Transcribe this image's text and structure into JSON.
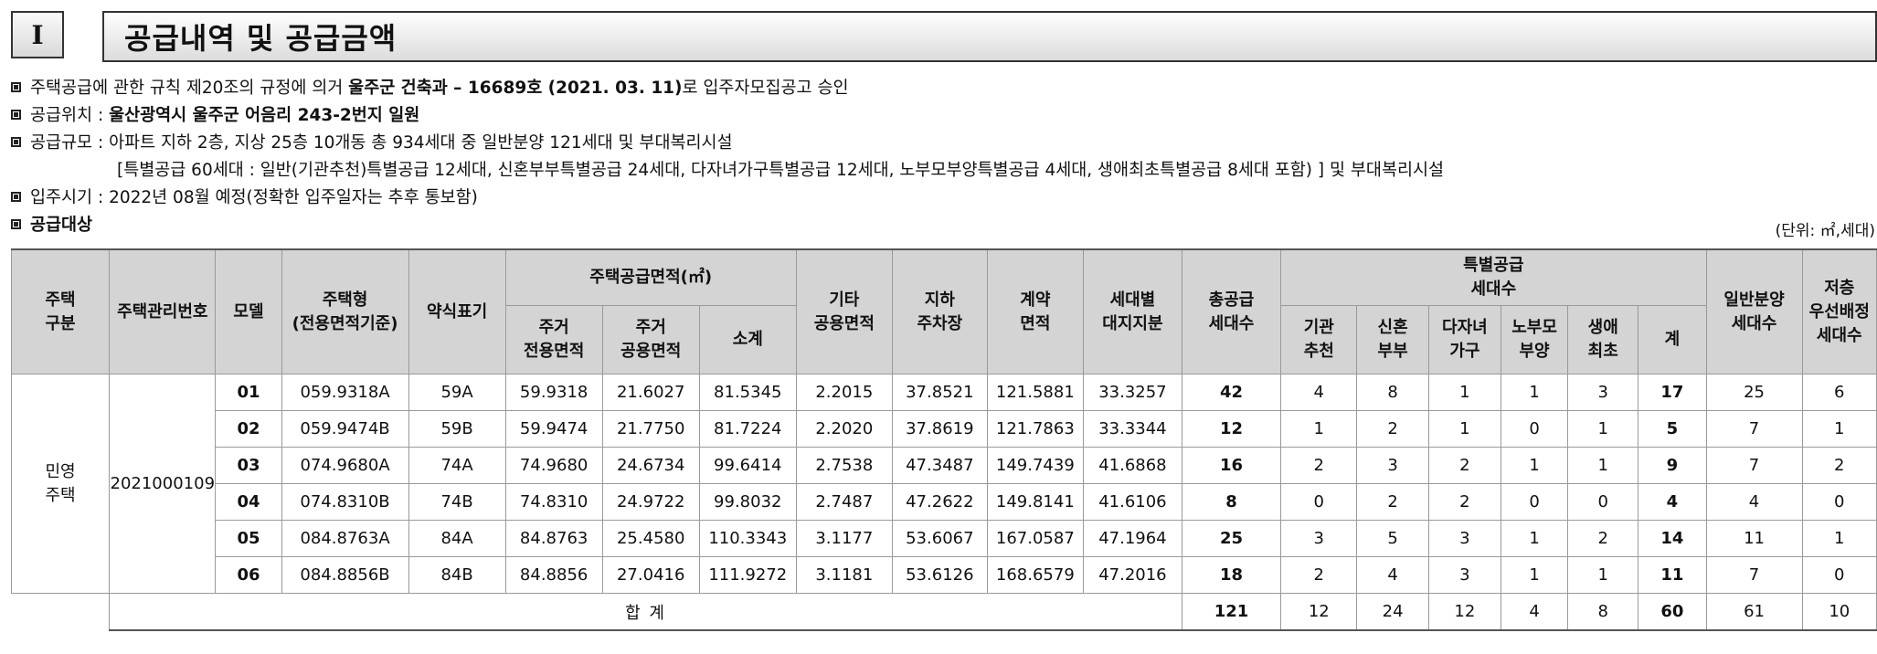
{
  "header": {
    "section_number": "I",
    "title": "공급내역 및 공급금액"
  },
  "info": {
    "line1_pre": "주택공급에 관한 규칙 제20조의 규정에 의거 ",
    "line1_bold": "울주군 건축과 – 16689호 (2021. 03. 11)",
    "line1_post": "로 입주자모집공고 승인",
    "line2_pre": "공급위치 : ",
    "line2_bold": "울산광역시 울주군 어음리 243-2번지 일원",
    "line3": "공급규모 : 아파트 지하 2층, 지상 25층 10개동 총 934세대 중 일반분양 121세대 및 부대복리시설",
    "line3_sub": "[특별공급 60세대 : 일반(기관추천)특별공급 12세대, 신혼부부특별공급 24세대, 다자녀가구특별공급 12세대, 노부모부양특별공급 4세대, 생애최초특별공급 8세대 포함) ] 및 부대복리시설",
    "line4": "입주시기 : 2022년 08월 예정(정확한 입주일자는 추후 통보함)",
    "line5": "공급대상",
    "unit": "(단위: ㎡,세대)"
  },
  "table": {
    "h_type": "주택\n구분",
    "h_mgmt": "주택관리번호",
    "h_model": "모델",
    "h_housing_type": "주택형\n(전용면적기준)",
    "h_abbrev": "약식표기",
    "h_area": "주택공급면적(㎡)",
    "h_excl": "주거\n전용면적",
    "h_common": "주거\n공용면적",
    "h_subtotal": "소계",
    "h_other": "기타\n공용면적",
    "h_parking": "지하\n주차장",
    "h_contract": "계약\n면적",
    "h_land": "세대별\n대지지분",
    "h_total_supply": "총공급\n세대수",
    "h_special": "특별공급\n세대수",
    "h_agency": "기관\n추천",
    "h_newlywed": "신혼\n부부",
    "h_multichild": "다자녀\n가구",
    "h_elderly": "노부모\n부양",
    "h_first": "생애\n최초",
    "h_sum": "계",
    "h_general": "일반분양\n세대수",
    "h_lowfloor": "저층\n우선배정\n세대수",
    "row_type": "민영\n주택",
    "row_mgmt": "2021000109",
    "rows": [
      [
        "01",
        "059.9318A",
        "59A",
        "59.9318",
        "21.6027",
        "81.5345",
        "2.2015",
        "37.8521",
        "121.5881",
        "33.3257",
        "42",
        "4",
        "8",
        "1",
        "1",
        "3",
        "17",
        "25",
        "6"
      ],
      [
        "02",
        "059.9474B",
        "59B",
        "59.9474",
        "21.7750",
        "81.7224",
        "2.2020",
        "37.8619",
        "121.7863",
        "33.3344",
        "12",
        "1",
        "2",
        "1",
        "0",
        "1",
        "5",
        "7",
        "1"
      ],
      [
        "03",
        "074.9680A",
        "74A",
        "74.9680",
        "24.6734",
        "99.6414",
        "2.7538",
        "47.3487",
        "149.7439",
        "41.6868",
        "16",
        "2",
        "3",
        "2",
        "1",
        "1",
        "9",
        "7",
        "2"
      ],
      [
        "04",
        "074.8310B",
        "74B",
        "74.8310",
        "24.9722",
        "99.8032",
        "2.7487",
        "47.2622",
        "149.8141",
        "41.6106",
        "8",
        "0",
        "2",
        "2",
        "0",
        "0",
        "4",
        "4",
        "0"
      ],
      [
        "05",
        "084.8763A",
        "84A",
        "84.8763",
        "25.4580",
        "110.3343",
        "3.1177",
        "53.6067",
        "167.0587",
        "47.1964",
        "25",
        "3",
        "5",
        "3",
        "1",
        "2",
        "14",
        "11",
        "1"
      ],
      [
        "06",
        "084.8856B",
        "84B",
        "84.8856",
        "27.0416",
        "111.9272",
        "3.1181",
        "53.6126",
        "168.6579",
        "47.2016",
        "18",
        "2",
        "4",
        "3",
        "1",
        "1",
        "11",
        "7",
        "0"
      ]
    ],
    "total_label": "합  계",
    "totals": [
      "121",
      "12",
      "24",
      "12",
      "4",
      "8",
      "60",
      "61",
      "10"
    ]
  }
}
